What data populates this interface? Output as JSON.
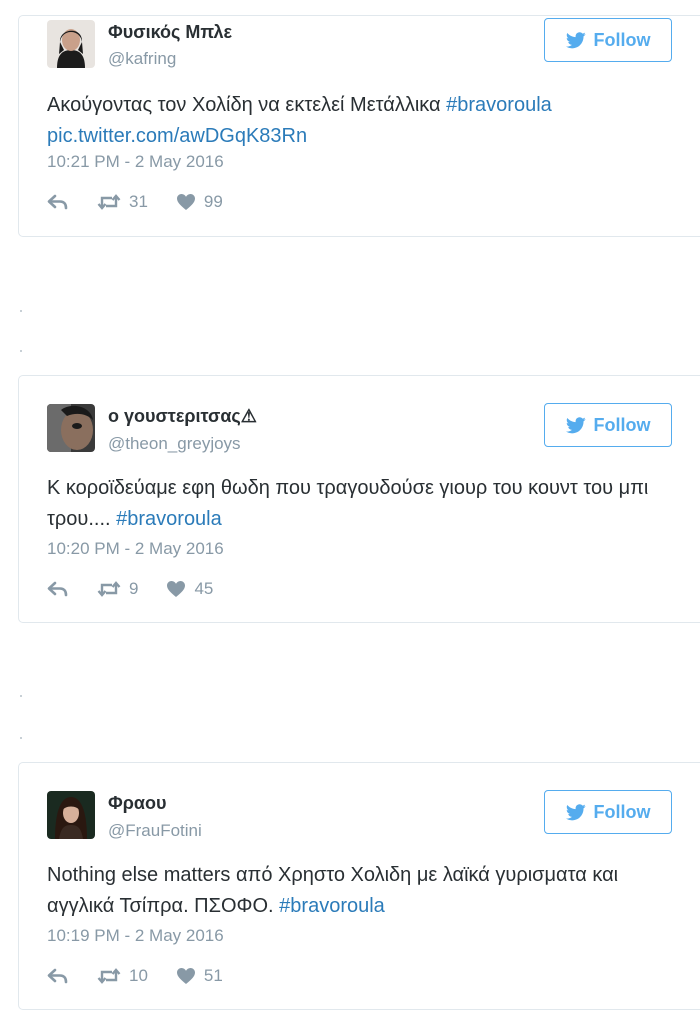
{
  "tweets": [
    {
      "name": "Φυσικός Μπλε",
      "handle": "@kafring",
      "follow_label": "Follow",
      "text": "Ακούγοντας τον Χολίδη να εκτελεί Μετάλλικα ",
      "hashtag": "#bravoroula",
      "link": "pic.twitter.com/awDGqK83Rn",
      "time": "10:21 PM - 2 May 2016",
      "retweets": "31",
      "likes": "99"
    },
    {
      "name": "ο γουστεριτσας⚠",
      "handle": "@theon_greyjoys",
      "follow_label": "Follow",
      "text": "Κ κοροϊδεύαμε εφη θωδη που τραγουδούσε γιουρ του κουντ του μπι τρου.... ",
      "hashtag": "#bravoroula",
      "time": "10:20 PM - 2 May 2016",
      "retweets": "9",
      "likes": "45"
    },
    {
      "name": "Φραου",
      "handle": "@FrauFotini",
      "follow_label": "Follow",
      "text": "Nothing else matters από Χρηστο Χολιδη με λαϊκά γυρισματα και αγγλικά Τσίπρα. ΠΣΟΦΟ. ",
      "hashtag": "#bravoroula",
      "time": "10:19 PM - 2 May 2016",
      "retweets": "10",
      "likes": "51"
    }
  ],
  "colors": {
    "accent": "#55acee",
    "link": "#2b7bb9",
    "muted": "#8899a6",
    "text": "#292f33",
    "border": "#e1e8ed"
  },
  "icons": [
    "twitter-bird-icon",
    "reply-icon",
    "retweet-icon",
    "heart-icon"
  ]
}
